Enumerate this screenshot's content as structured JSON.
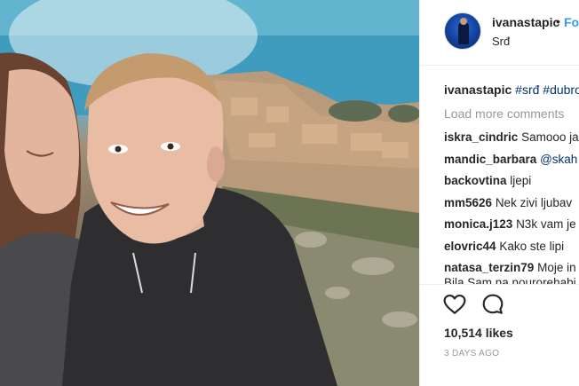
{
  "post": {
    "username": "ivanastapic",
    "separator": "•",
    "follow_label": "Fo",
    "location": "Srđ",
    "caption": {
      "username": "ivanastapic",
      "text": "#srđ #dubro"
    },
    "load_more_label": "Load more comments",
    "comments": [
      {
        "user": "iskra_cindric",
        "text": "Samooo ja"
      },
      {
        "user": "mandic_barbara",
        "text": "@skah"
      },
      {
        "user": "backovtina",
        "text": "ljepi"
      },
      {
        "user": "mm5626",
        "text": "Nek zivi ljubav"
      },
      {
        "user": "monica.j123",
        "text": "N3k vam je"
      },
      {
        "user": "elovric44",
        "text": "Kako ste lipi"
      },
      {
        "user": "natasa_terzin79",
        "text": "Moje in"
      },
      {
        "user": "",
        "text": "Bila Sam na nourorehabi"
      }
    ],
    "likes": "10,514 likes",
    "time_ago": "3 DAYS AGO"
  },
  "icons": {
    "like": "heart-icon",
    "comment": "comment-bubble-icon",
    "avatar": "avatar"
  },
  "colors": {
    "link": "#003569",
    "follow": "#3897f0",
    "muted": "#999999",
    "text": "#262626"
  }
}
